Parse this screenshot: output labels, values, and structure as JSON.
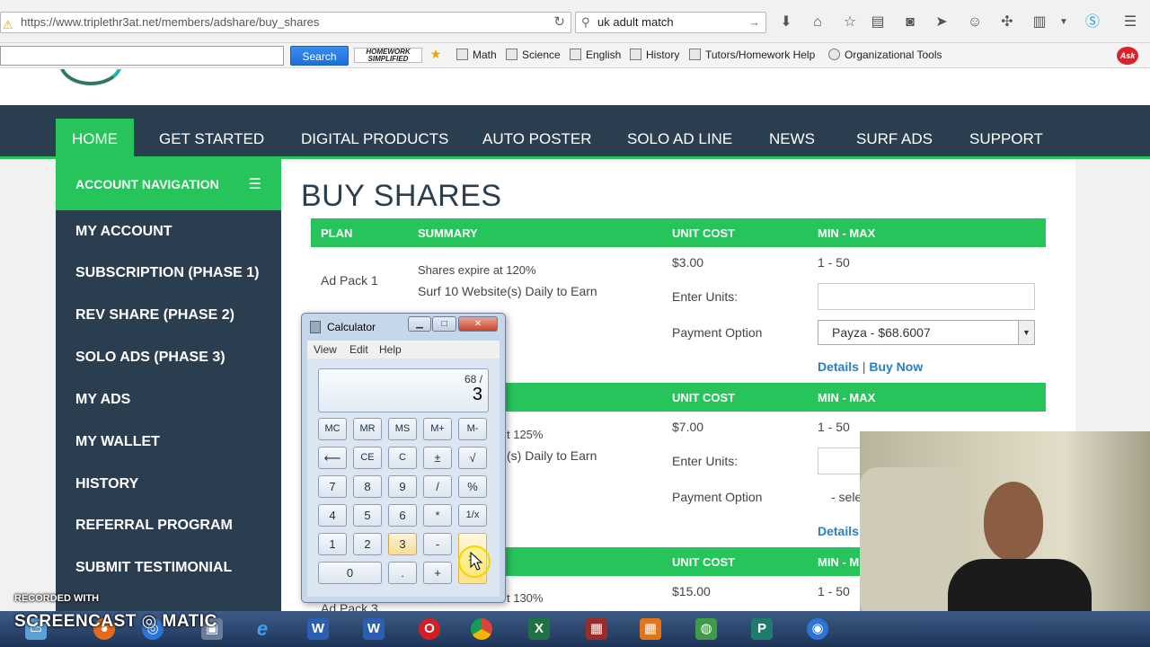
{
  "browser": {
    "url": "https://www.triplethr3at.net/members/adshare/buy_shares",
    "search_query": "uk adult match",
    "icons": [
      "download-icon",
      "home-icon",
      "star-icon",
      "reading-list-icon",
      "pocket-icon",
      "send-icon",
      "chat-icon",
      "extensions-icon",
      "clipboard-icon",
      "skype-icon",
      "menu-icon"
    ]
  },
  "bookmarks": {
    "search_label": "Search",
    "logo_text": "Homework Simplified",
    "items": [
      {
        "label": "Math"
      },
      {
        "label": "Science"
      },
      {
        "label": "English"
      },
      {
        "label": "History"
      },
      {
        "label": "Tutors/Homework Help"
      },
      {
        "label": "Organizational Tools"
      }
    ],
    "ask_logo": "Ask"
  },
  "nav": {
    "items": [
      {
        "label": "HOME"
      },
      {
        "label": "GET STARTED"
      },
      {
        "label": "DIGITAL PRODUCTS"
      },
      {
        "label": "AUTO POSTER"
      },
      {
        "label": "SOLO AD LINE"
      },
      {
        "label": "NEWS"
      },
      {
        "label": "SURF ADS"
      },
      {
        "label": "SUPPORT"
      }
    ]
  },
  "sidebar": {
    "header": "ACCOUNT NAVIGATION",
    "items": [
      {
        "label": "MY ACCOUNT"
      },
      {
        "label": "SUBSCRIPTION (PHASE 1)"
      },
      {
        "label": "REV SHARE (PHASE 2)"
      },
      {
        "label": "SOLO ADS (PHASE 3)"
      },
      {
        "label": "MY ADS"
      },
      {
        "label": "MY WALLET"
      },
      {
        "label": "HISTORY"
      },
      {
        "label": "REFERRAL PROGRAM"
      },
      {
        "label": "SUBMIT TESTIMONIAL"
      }
    ]
  },
  "main": {
    "title": "BUY SHARES",
    "columns": [
      "PLAN",
      "SUMMARY",
      "UNIT COST",
      "MIN - MAX"
    ],
    "plans": [
      {
        "name": "Ad Pack 1",
        "summary_line1": "Shares expire at 120%",
        "summary_line2": "Surf 10 Website(s) Daily to Earn",
        "unit_cost": "$3.00",
        "min_max": "1 - 50",
        "enter_units_label": "Enter Units:",
        "payment_label": "Payment Option",
        "payment_value": "Payza - $68.6007",
        "details": "Details",
        "buy_now": "Buy Now"
      },
      {
        "name": "",
        "summary_line1": "t 125%",
        "summary_line2": "(s) Daily to Earn",
        "unit_cost": "$7.00",
        "min_max": "1 - 50",
        "enter_units_label": "Enter Units:",
        "payment_label": "Payment Option",
        "payment_value": "- sele",
        "details": "Details"
      },
      {
        "name": "Ad Pack 3",
        "summary_line1": "t 130%",
        "unit_cost": "$15.00",
        "min_max": "1 - 50",
        "col_min_max": "MIN - M"
      }
    ],
    "separator": "|"
  },
  "calculator": {
    "title": "Calculator",
    "menu": [
      "View",
      "Edit",
      "Help"
    ],
    "expression": "68  /",
    "value": "3",
    "keys": {
      "mc": "MC",
      "mr": "MR",
      "ms": "MS",
      "mplus": "M+",
      "mminus": "M-",
      "back": "⟵",
      "ce": "CE",
      "c": "C",
      "pm": "±",
      "sqrt": "√",
      "k7": "7",
      "k8": "8",
      "k9": "9",
      "div": "/",
      "pct": "%",
      "k4": "4",
      "k5": "5",
      "k6": "6",
      "mul": "*",
      "recip": "1/x",
      "k1": "1",
      "k2": "2",
      "k3": "3",
      "sub": "-",
      "eq": "=",
      "k0": "0",
      "dot": ".",
      "add": "+"
    }
  },
  "watermark": {
    "line1": "RECORDED WITH",
    "line2": "SCREENCAST ◎ MATIC"
  },
  "colors": {
    "nav_bg": "#2b3e50",
    "accent_green": "#27c45b",
    "link_blue": "#2a7fc2"
  }
}
